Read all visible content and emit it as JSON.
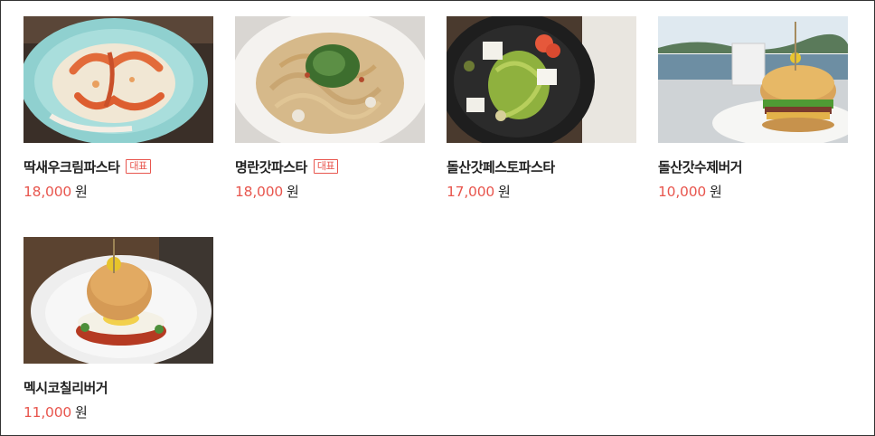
{
  "menu": {
    "items": [
      {
        "name": "딱새우크림파스타",
        "badge": "대표",
        "price": "18,000",
        "currency": "원",
        "photo": "shrimp-cream-pasta"
      },
      {
        "name": "명란갓파스타",
        "badge": "대표",
        "price": "18,000",
        "currency": "원",
        "photo": "pollack-roe-mustard-greens-pasta"
      },
      {
        "name": "돌산갓페스토파스타",
        "price": "17,000",
        "currency": "원",
        "photo": "mustard-greens-pesto-pasta"
      },
      {
        "name": "돌산갓수제버거",
        "price": "10,000",
        "currency": "원",
        "photo": "mustard-greens-burger"
      },
      {
        "name": "멕시코칠리버거",
        "price": "11,000",
        "currency": "원",
        "photo": "mexican-chili-burger"
      }
    ]
  },
  "colors": {
    "price": "#e8564e",
    "badge": "#e8564e",
    "name": "#222222"
  }
}
